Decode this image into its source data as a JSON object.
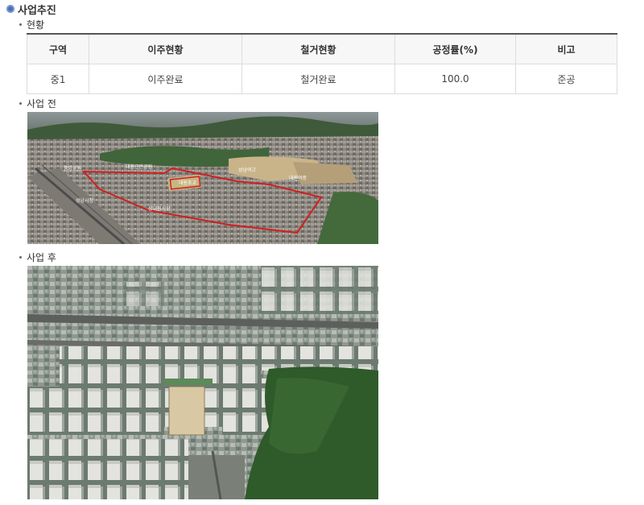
{
  "section_title": "사업추진",
  "status": {
    "label": "현황",
    "headers": [
      "구역",
      "이주현황",
      "철거현황",
      "공정률(%)",
      "비고"
    ],
    "row": [
      "중1",
      "이주완료",
      "철거완료",
      "100.0",
      "준공"
    ]
  },
  "before": {
    "label": "사업 전",
    "map_labels": [
      "대원근린공원",
      "대원초교",
      "성남여고",
      "대원여중",
      "중앙공원",
      "성남시청",
      "상대원시장"
    ]
  },
  "after": {
    "label": "사업 후"
  },
  "colors": {
    "accent": "#4a6fb5",
    "boundary": "#d21f1f"
  }
}
